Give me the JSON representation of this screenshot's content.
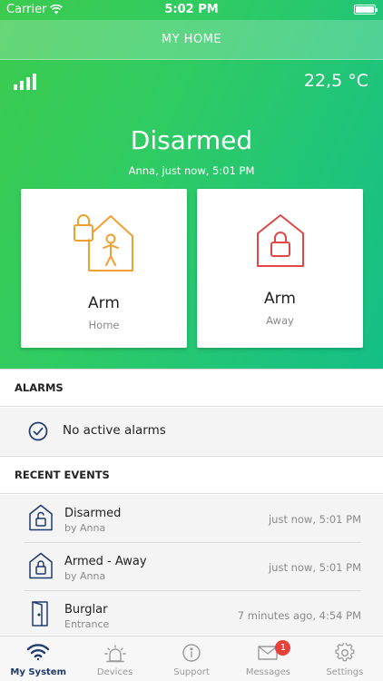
{
  "status_bar": {
    "carrier": "Carrier",
    "time": "5:02 PM"
  },
  "nav": {
    "title": "MY HOME"
  },
  "system": {
    "temperature": "22,5 °C",
    "state": "Disarmed",
    "state_detail": "Anna, just now, 5:01 PM"
  },
  "cards": [
    {
      "title": "Arm",
      "subtitle": "Home",
      "icon": "house-person-lock-icon",
      "color": "#f0a030"
    },
    {
      "title": "Arm",
      "subtitle": "Away",
      "icon": "house-lock-icon",
      "color": "#e04848"
    }
  ],
  "alarms": {
    "header": "ALARMS",
    "status": "No active alarms",
    "icon": "check-circle-icon"
  },
  "recent_events": {
    "header": "RECENT EVENTS",
    "items": [
      {
        "title": "Disarmed",
        "subtitle": "by Anna",
        "time": "just now, 5:01 PM",
        "icon": "house-unlock-icon"
      },
      {
        "title": "Armed - Away",
        "subtitle": "by Anna",
        "time": "just now, 5:01 PM",
        "icon": "house-lock-icon"
      },
      {
        "title": "Burglar",
        "subtitle": "Entrance",
        "time": "7 minutes ago, 4:54 PM",
        "icon": "door-icon"
      }
    ]
  },
  "tabs": [
    {
      "label": "My System",
      "icon": "wifi-icon",
      "active": true
    },
    {
      "label": "Devices",
      "icon": "siren-icon"
    },
    {
      "label": "Support",
      "icon": "info-icon"
    },
    {
      "label": "Messages",
      "icon": "envelope-icon",
      "badge": "1"
    },
    {
      "label": "Settings",
      "icon": "gear-icon"
    }
  ],
  "colors": {
    "accent": "#1e3a6e",
    "gradient_start": "#3ccb4e",
    "gradient_end": "#14bf86",
    "badge": "#e8413b"
  }
}
